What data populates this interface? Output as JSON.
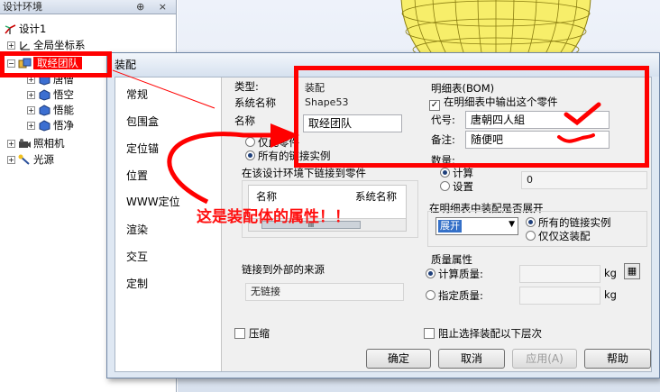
{
  "tree": {
    "title": "设计环境",
    "title_icons": "⊕ ×",
    "root": "设计1",
    "global_cs": "全局坐标系",
    "selected": "取经团队",
    "children": [
      "唐僧",
      "悟空",
      "悟能",
      "悟净"
    ],
    "camera": "照相机",
    "light": "光源"
  },
  "dialog": {
    "title": "装配",
    "menu": [
      "常规",
      "包围盒",
      "定位锚",
      "位置",
      "WWW定位",
      "渲染",
      "交互",
      "定制"
    ],
    "type_label": "类型:",
    "type_value": "装配",
    "sysname_label": "系统名称",
    "sysname_value": "Shape53",
    "name_label": "名称",
    "name_value": "取经团队",
    "radio_only_part": "仅此零件",
    "radio_all_links": "所有的链接实例",
    "linked_group_title": "在该设计环境下链接到零件",
    "col_name": "名称",
    "col_sysname": "系统名称",
    "scroll_mark": "III",
    "external_title": "链接到外部的来源",
    "external_value": "无链接",
    "compress_label": "压缩",
    "bom_title": "明细表(BOM)",
    "bom_output": "在明细表中输出这个零件",
    "code_label": "代号:",
    "code_value": "唐朝四人組",
    "note_label": "备注:",
    "note_value": "随便吧",
    "qty_label": "数量:",
    "qty_calc": "计算",
    "qty_set": "设置",
    "qty_val1": "0",
    "qty_val2": "0",
    "expand_title": "在明细表中装配是否展开",
    "expand_select": "展开",
    "expand_all": "所有的链接实例",
    "expand_only": "仅仅这装配",
    "mass_title": "质量属性",
    "mass_calc": "计算质量:",
    "mass_set": "指定质量:",
    "mass_unit1": "kg",
    "mass_unit2": "kg",
    "block_label": "阻止选择装配以下层次",
    "btn_ok": "确定",
    "btn_cancel": "取消",
    "btn_apply": "应用(A)",
    "btn_help": "帮助"
  },
  "annotation": {
    "text": "这是装配体的属性！！",
    "color": "#ff0000"
  }
}
